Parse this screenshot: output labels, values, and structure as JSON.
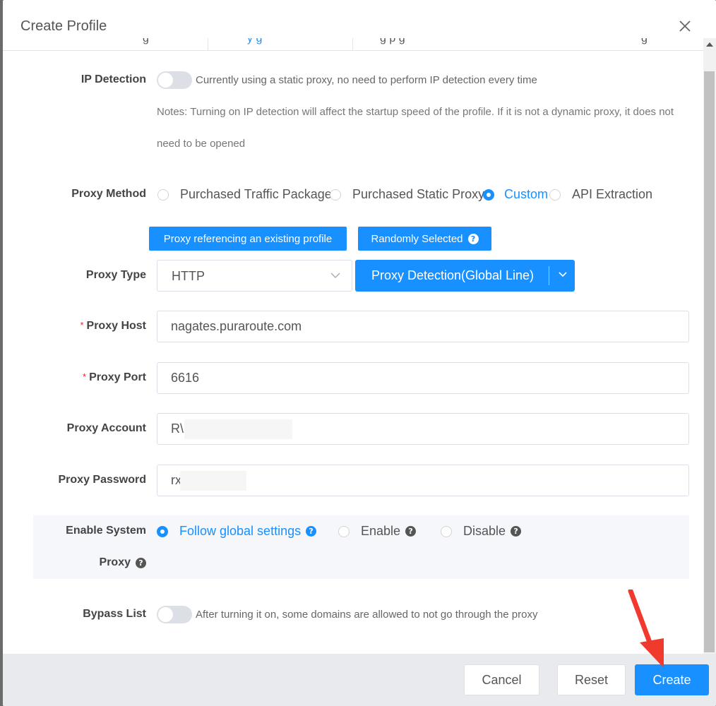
{
  "dialog": {
    "title": "Create Profile",
    "tabs": [
      "g",
      "y g",
      "g p g",
      "g"
    ]
  },
  "ip_detection": {
    "label": "IP Detection",
    "enabled": false,
    "hint": "Currently using a static proxy, no need to perform IP detection every time",
    "note_line1": "Notes: Turning on IP detection will affect the startup speed of the profile. If it is not a dynamic proxy, it does not",
    "note_line2": "need to be opened"
  },
  "proxy_method": {
    "label": "Proxy Method",
    "options": [
      "Purchased Traffic Package",
      "Purchased Static Proxy",
      "Custom",
      "API Extraction"
    ],
    "selected": "Custom"
  },
  "buttons": {
    "reference_profile": "Proxy referencing an existing profile",
    "randomly_selected": "Randomly Selected",
    "help_glyph": "?"
  },
  "proxy_type": {
    "label": "Proxy Type",
    "value": "HTTP",
    "detect_label": "Proxy Detection(Global Line)"
  },
  "proxy_host": {
    "label": "Proxy Host",
    "value": "nagates.puraroute.com",
    "required_mark": "*"
  },
  "proxy_port": {
    "label": "Proxy Port",
    "value": "6616",
    "required_mark": "*"
  },
  "proxy_account": {
    "label": "Proxy Account",
    "value": "R\\"
  },
  "proxy_password": {
    "label": "Proxy Password",
    "value": "rx"
  },
  "system_proxy": {
    "label_line1": "Enable System",
    "label_line2": "Proxy",
    "options": [
      "Follow global settings",
      "Enable",
      "Disable"
    ],
    "selected": "Follow global settings"
  },
  "bypass_list": {
    "label": "Bypass List",
    "enabled": false,
    "hint": "After turning it on, some domains are allowed to not go through the proxy"
  },
  "footer": {
    "cancel": "Cancel",
    "reset": "Reset",
    "create": "Create"
  },
  "colors": {
    "primary": "#1890ff",
    "annotation": "#f03a2e",
    "required": "#f5222d"
  },
  "icons": [
    "close-icon",
    "chevron-down-icon",
    "question-circle-icon",
    "annotation-arrow-icon"
  ]
}
